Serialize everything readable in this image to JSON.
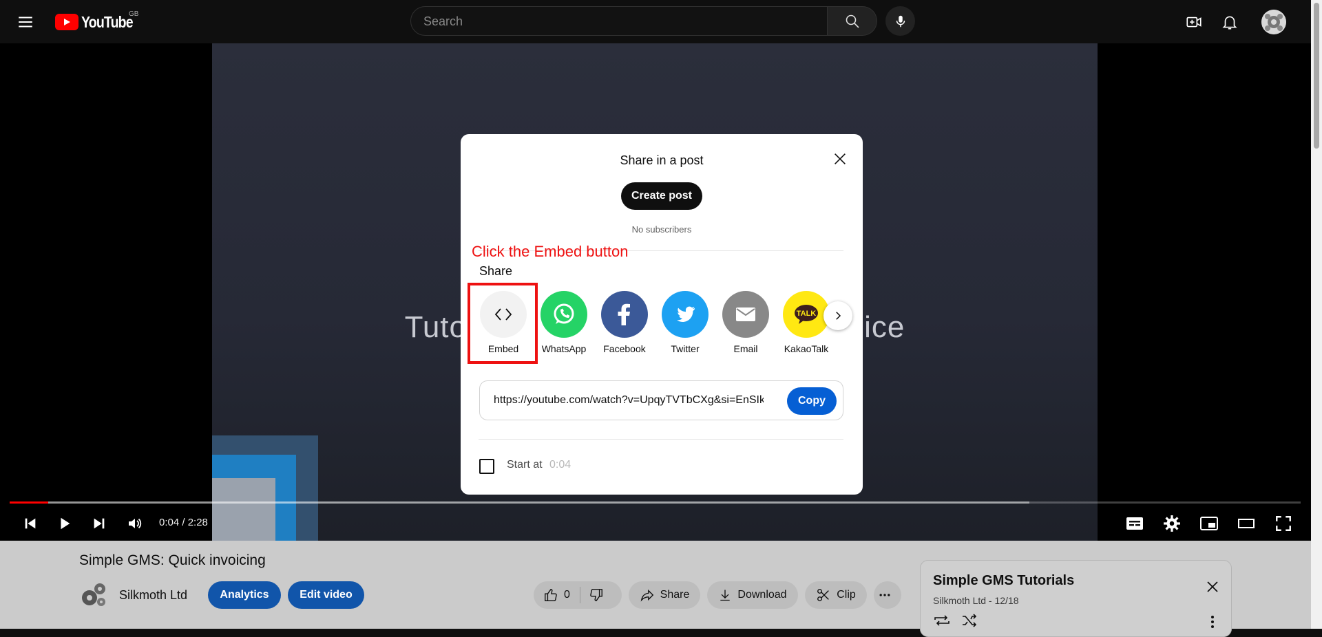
{
  "header": {
    "logo_text": "YouTube",
    "region": "GB",
    "search_placeholder": "Search"
  },
  "player": {
    "video_title_overlay": "Tutorial: Simple GMS Quick Invoice",
    "current_time": "0:04 / 2:28",
    "progress": 0.03,
    "buffered": 0.79
  },
  "video": {
    "title": "Simple GMS: Quick invoicing",
    "channel": "Silkmoth Ltd",
    "analytics_label": "Analytics",
    "edit_label": "Edit video",
    "like_count": "0",
    "share_label": "Share",
    "download_label": "Download",
    "clip_label": "Clip"
  },
  "playlist": {
    "title": "Simple GMS Tutorials",
    "subtitle": "Silkmoth Ltd - 12/18"
  },
  "share_dialog": {
    "title": "Share in a post",
    "create_post_label": "Create post",
    "no_subscribers": "No subscribers",
    "annotation": "Click the Embed button",
    "share_heading": "Share",
    "targets": [
      {
        "label": "Embed",
        "color": "#f2f2f2",
        "icon": "embed-icon"
      },
      {
        "label": "WhatsApp",
        "color": "#25d366",
        "icon": "whatsapp-icon"
      },
      {
        "label": "Facebook",
        "color": "#3b5998",
        "icon": "facebook-icon"
      },
      {
        "label": "Twitter",
        "color": "#1da1f2",
        "icon": "twitter-icon"
      },
      {
        "label": "Email",
        "color": "#888888",
        "icon": "email-icon"
      },
      {
        "label": "KakaoTalk",
        "color": "#ffe812",
        "icon": "kakaotalk-icon"
      }
    ],
    "url": "https://youtube.com/watch?v=UpqyTVTbCXg&si=EnSIkaIECMiOmarE",
    "copy_label": "Copy",
    "start_at_label": "Start at",
    "start_at_value": "0:04"
  },
  "colors": {
    "youtube_red": "#ff0000",
    "annotation_red": "#ee1111",
    "copy_blue": "#065fd4"
  }
}
